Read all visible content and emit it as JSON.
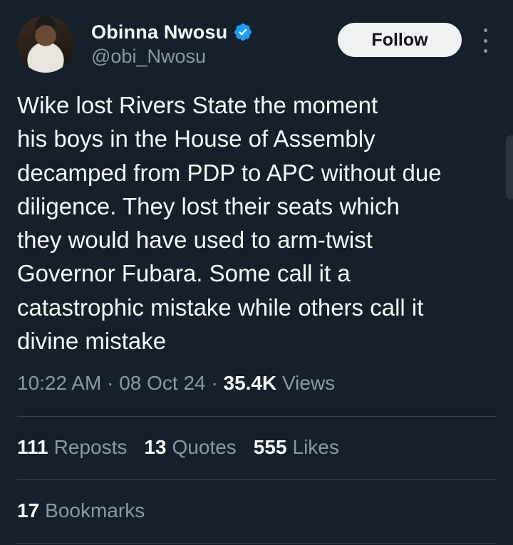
{
  "author": {
    "display_name": "Obinna Nwosu",
    "handle": "@obi_Nwosu",
    "verified_icon": "verified-badge-icon",
    "avatar_icon": "profile-avatar"
  },
  "follow_button": {
    "label": "Follow"
  },
  "more_menu": {
    "icon": "more-vertical-icon"
  },
  "tweet": {
    "text": "Wike lost Rivers State the moment\nhis boys in the House of Assembly\ndecamped from PDP to APC without due\ndiligence. They lost their seats which\nthey would have used to arm-twist\nGovernor Fubara. Some call it a\ncatastrophic mistake while others call it\ndivine mistake"
  },
  "meta": {
    "time": "10:22 AM",
    "separator1": " · ",
    "date": "08 Oct 24",
    "separator2": " · ",
    "views_count": "35.4K",
    "views_label": "Views"
  },
  "stats": {
    "reposts_count": "111",
    "reposts_label": "Reposts",
    "quotes_count": "13",
    "quotes_label": "Quotes",
    "likes_count": "555",
    "likes_label": "Likes",
    "bookmarks_count": "17",
    "bookmarks_label": "Bookmarks"
  },
  "colors": {
    "background": "#15202b",
    "primary_text": "#f7f9f9",
    "secondary_text": "#8b98a5",
    "divider": "#38444d",
    "verified_blue": "#1d9bf0",
    "follow_bg": "#eff3f4"
  }
}
